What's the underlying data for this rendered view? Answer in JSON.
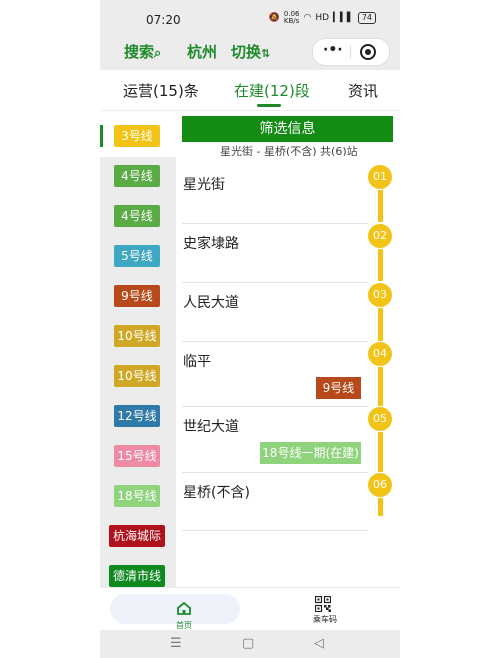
{
  "status_bar": {
    "time": "07:20",
    "network_speed": "0.06\nKB/s",
    "signal": "HD",
    "battery": "74"
  },
  "top_bar": {
    "search_label": "搜索",
    "city": "杭州",
    "switch_label": "切换"
  },
  "tabs": [
    {
      "label": "运营(15)条",
      "active": false
    },
    {
      "label": "在建(12)段",
      "active": true
    },
    {
      "label": "资讯",
      "active": false
    }
  ],
  "sidebar": {
    "items": [
      {
        "label": "3号线",
        "color": "#f2c417",
        "active": true
      },
      {
        "label": "4号线",
        "color": "#5aaa46",
        "active": false
      },
      {
        "label": "4号线",
        "color": "#5aaa46",
        "active": false
      },
      {
        "label": "5号线",
        "color": "#3ea7c2",
        "active": false
      },
      {
        "label": "9号线",
        "color": "#b8491a",
        "active": false
      },
      {
        "label": "10号线",
        "color": "#d1a826",
        "active": false
      },
      {
        "label": "10号线",
        "color": "#d1a826",
        "active": false
      },
      {
        "label": "12号线",
        "color": "#2f7aa8",
        "active": false
      },
      {
        "label": "15号线",
        "color": "#ef8aa5",
        "active": false
      },
      {
        "label": "18号线",
        "color": "#8fd47c",
        "active": false
      },
      {
        "label": "杭海城际",
        "color": "#b0121b",
        "active": false
      },
      {
        "label": "德清市线",
        "color": "#0f8a1f",
        "active": false
      }
    ]
  },
  "main": {
    "filter_button": "筛选信息",
    "summary": "星光街 - 星桥(不含) 共(6)站",
    "stations": [
      {
        "number": "01",
        "name": "星光街",
        "transfers": []
      },
      {
        "number": "02",
        "name": "史家埭路",
        "transfers": []
      },
      {
        "number": "03",
        "name": "人民大道",
        "transfers": []
      },
      {
        "number": "04",
        "name": "临平",
        "transfers": [
          {
            "label": "9号线",
            "color": "#b8491a"
          }
        ]
      },
      {
        "number": "05",
        "name": "世纪大道",
        "transfers": [
          {
            "label": "18号线一期(在建)",
            "color": "#8fd47c"
          }
        ]
      },
      {
        "number": "06",
        "name": "星桥(不含)",
        "transfers": []
      }
    ],
    "line_color": "#f2c417"
  },
  "bottom_nav": {
    "home_label": "首页",
    "ride_label": "乘车码"
  },
  "colors": {
    "brand_green": "#1f8a2a",
    "filter_green": "#148c14"
  }
}
